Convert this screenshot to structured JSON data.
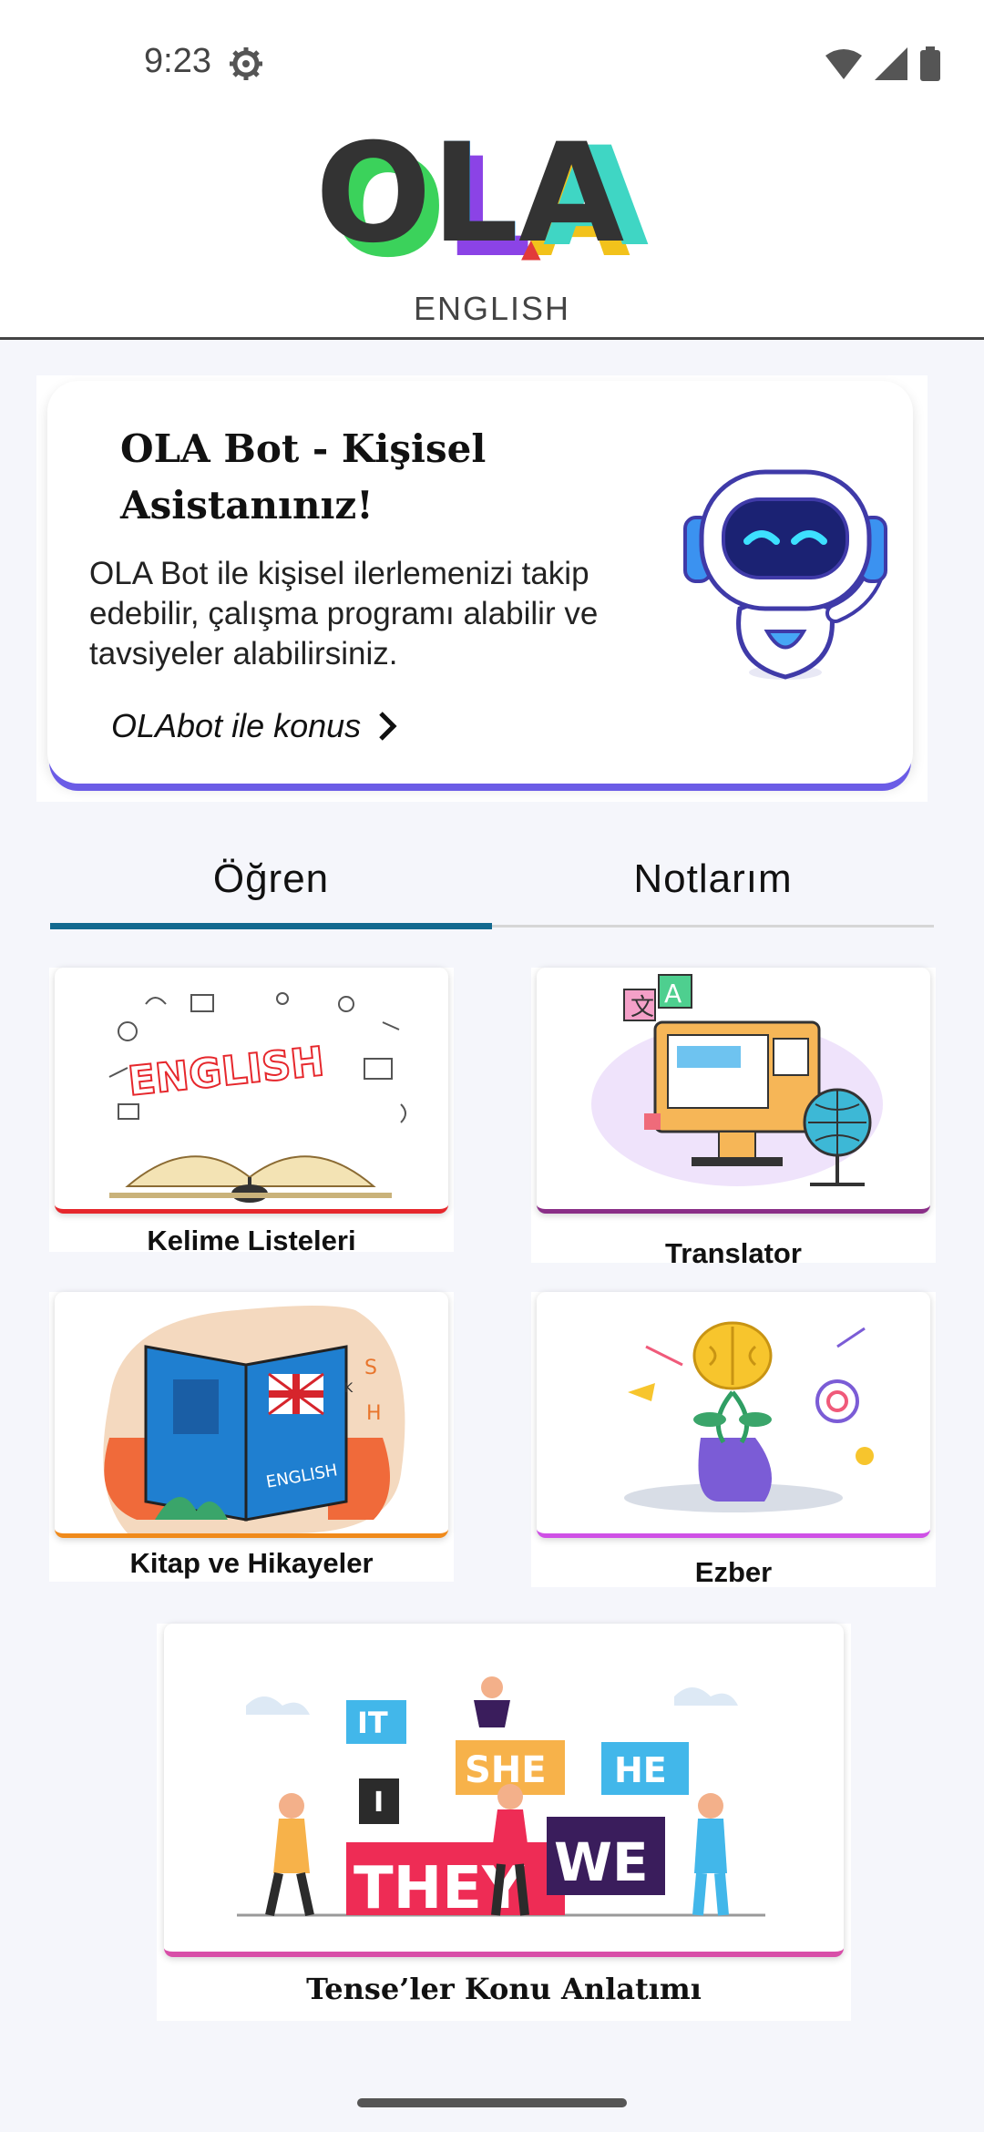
{
  "status_bar": {
    "time": "9:23"
  },
  "header": {
    "logo_text": "OLA",
    "logo_subtitle": "ENGLISH"
  },
  "bot_card": {
    "title": "OLA Bot - Kişisel Asistanınız!",
    "description": "OLA Bot ile kişisel ilerlemenizi takip edebilir, çalışma programı alabilir ve tavsiyeler alabilirsiniz.",
    "link_label": "OLAbot ile konus"
  },
  "tabs": [
    {
      "label": "Öğren",
      "selected": true
    },
    {
      "label": "Notlarım",
      "selected": false
    }
  ],
  "tiles": [
    {
      "label": "Kelime Listeleri",
      "accent": "#e6272c",
      "art_text": "ENGLISH"
    },
    {
      "label": "Translator",
      "accent": "#8a2e87",
      "art_text": "A"
    },
    {
      "label": "Kitap ve Hikayeler",
      "accent": "#f08a1b",
      "art_text": "ENGLISH"
    },
    {
      "label": "Ezber",
      "accent": "#cf50e6"
    },
    {
      "label": "Tense’ler Konu Anlatımı",
      "accent": "#d84ea8"
    }
  ],
  "tense_words": [
    "IT",
    "I",
    "SHE",
    "HE",
    "THEY",
    "WE"
  ],
  "colors": {
    "tab_indicator": "#13698f",
    "bot_shadow": "#6b5ce6"
  }
}
